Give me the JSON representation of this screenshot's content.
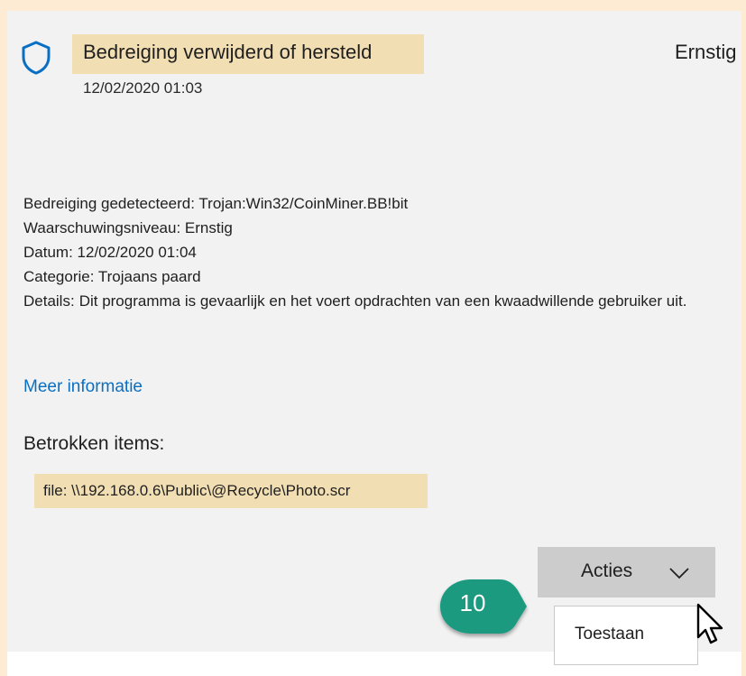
{
  "header": {
    "title": "Bedreiging verwijderd of hersteld",
    "timestamp": "12/02/2020 01:03",
    "severity": "Ernstig",
    "icon": "shield-icon"
  },
  "details": {
    "threat_label": "Bedreiging gedetecteerd:",
    "threat_value": "Trojan:Win32/CoinMiner.BB!bit",
    "level_label": "Waarschuwingsniveau:",
    "level_value": "Ernstig",
    "date_label": "Datum:",
    "date_value": "12/02/2020 01:04",
    "category_label": "Categorie:",
    "category_value": "Trojaans paard",
    "details_label": "Details:",
    "details_value": "Dit programma is gevaarlijk en het voert opdrachten van een kwaadwillende gebruiker uit."
  },
  "more_info_link": "Meer informatie",
  "affected": {
    "heading": "Betrokken items:",
    "file": "file: \\\\192.168.0.6\\Public\\@Recycle\\Photo.scr"
  },
  "actions": {
    "button_label": "Acties",
    "menu_items": [
      "Toestaan"
    ]
  },
  "step_badge": "10",
  "colors": {
    "accent_blue": "#0a6fc2",
    "highlight": "#f2deb3",
    "badge_green": "#1d9a80",
    "page_bg": "#fdebd3"
  }
}
